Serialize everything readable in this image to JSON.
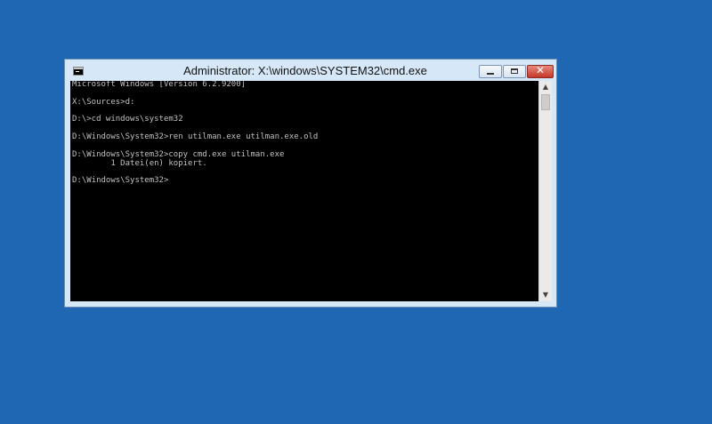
{
  "window": {
    "title": "Administrator: X:\\windows\\SYSTEM32\\cmd.exe",
    "icon": "console-app-icon",
    "controls": {
      "minimize_icon": "minimize-icon",
      "maximize_icon": "maximize-icon",
      "close_label": "✕"
    }
  },
  "console": {
    "lines": [
      "Microsoft Windows [Version 6.2.9200]",
      "",
      "X:\\Sources>d:",
      "",
      "D:\\>cd windows\\system32",
      "",
      "D:\\Windows\\System32>ren utilman.exe utilman.exe.old",
      "",
      "D:\\Windows\\System32>copy cmd.exe utilman.exe",
      "        1 Datei(en) kopiert.",
      "",
      "D:\\Windows\\System32>"
    ]
  },
  "scrollbar": {
    "up_arrow": "▲",
    "down_arrow": "▼"
  },
  "colors": {
    "desktop": "#1f66b3",
    "console_bg": "#000000",
    "console_text": "#c0c0c0",
    "close_button": "#c3382a"
  }
}
